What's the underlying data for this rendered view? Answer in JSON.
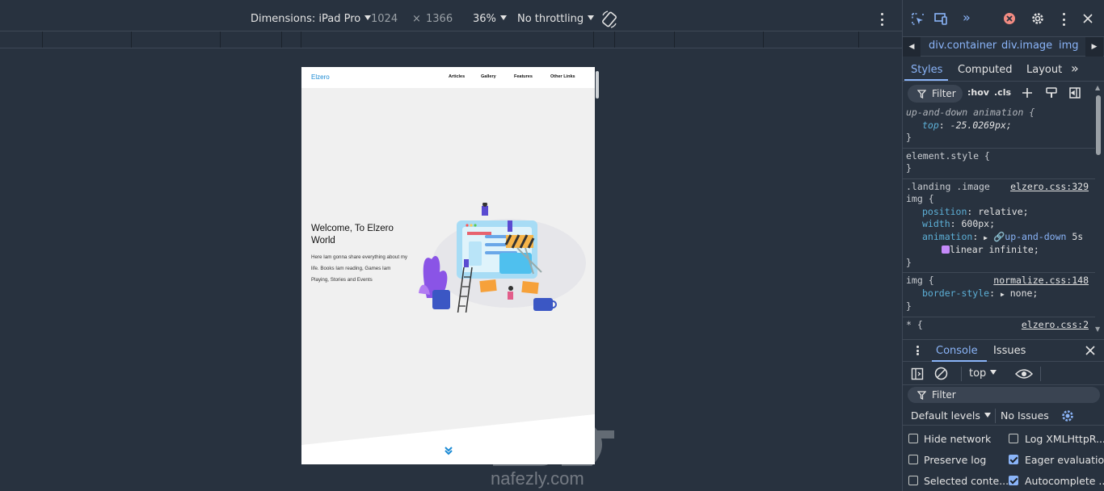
{
  "device_toolbar": {
    "dimensions_label": "Dimensions: iPad Pro",
    "width": "1024",
    "times": "×",
    "height": "1366",
    "zoom": "36%",
    "throttling": "No throttling"
  },
  "site": {
    "logo": "Elzero",
    "nav": [
      "Articles",
      "Gallery",
      "Features",
      "Other Links"
    ],
    "hero_title": "Welcome, To Elzero World",
    "hero_text": "Here Iam gonna share everything about my life. Books Iam reading, Games Iam Playing, Stories and Events"
  },
  "watermark": {
    "text": "nafezly.com"
  },
  "devtools": {
    "breadcrumbs": [
      "div.container",
      "div.image",
      "img"
    ],
    "tabs": [
      "Styles",
      "Computed",
      "Layout"
    ],
    "filter_placeholder": "Filter",
    "hov": ":hov",
    "cls": ".cls",
    "rules": [
      {
        "selector": "up-and-down animation {",
        "props": [
          {
            "name": "top",
            "value": "-25.0269px;"
          }
        ],
        "close": "}"
      },
      {
        "selector": "element.style {",
        "close": "}"
      },
      {
        "selector": ".landing .image",
        "selector2": "img {",
        "source": "elzero.css:329",
        "props": [
          {
            "name": "position",
            "value": "relative;"
          },
          {
            "name": "width",
            "value": "600px;"
          },
          {
            "name": "animation",
            "value": "up-and-down",
            "value2": "5s"
          }
        ],
        "cont": "linear infinite;",
        "close": "}"
      },
      {
        "selector": "img {",
        "source": "normalize.css:148",
        "props": [
          {
            "name": "border-style",
            "value": "none;"
          }
        ],
        "close": "}"
      },
      {
        "selector": "* {",
        "source": "elzero.css:2"
      }
    ],
    "console": {
      "tabs": [
        "Console",
        "Issues"
      ],
      "context": "top",
      "filter": "Filter",
      "levels": "Default levels",
      "issues": "No Issues",
      "options": [
        {
          "label": "Hide network",
          "checked": false
        },
        {
          "label": "Log XMLHttpR...",
          "checked": false
        },
        {
          "label": "Preserve log",
          "checked": false
        },
        {
          "label": "Eager evaluation",
          "checked": true
        },
        {
          "label": "Selected conte...",
          "checked": false
        },
        {
          "label": "Autocomplete ...",
          "checked": true
        }
      ]
    }
  },
  "colors": {
    "accent": "#8ab4f8",
    "panel": "#28323f",
    "error": "#f28b82",
    "logo": "#1a8ad4"
  }
}
